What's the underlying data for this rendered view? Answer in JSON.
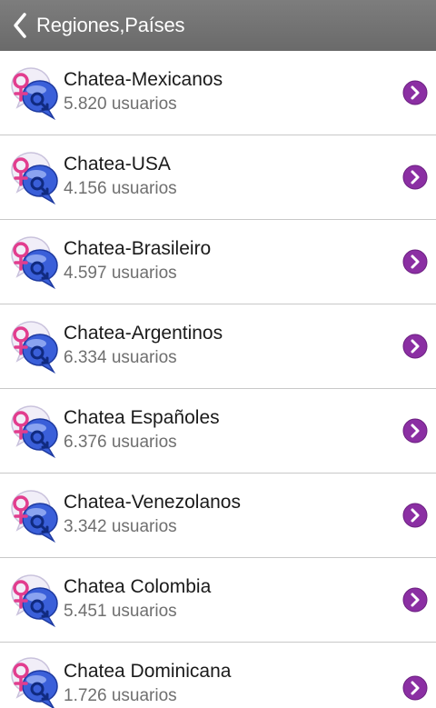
{
  "header": {
    "title": "Regiones,Países"
  },
  "icons": {
    "back": "chevron-left-icon",
    "item": "gender-chat-bubble-icon",
    "go": "purple-chevron-right-icon"
  },
  "colors": {
    "header": "#747474",
    "accent": "#8b2fa3",
    "divider": "#c8c8c8"
  },
  "rooms": [
    {
      "name": "Chatea-Mexicanos",
      "users": "5.820 usuarios"
    },
    {
      "name": "Chatea-USA",
      "users": "4.156 usuarios"
    },
    {
      "name": "Chatea-Brasileiro",
      "users": "4.597 usuarios"
    },
    {
      "name": "Chatea-Argentinos",
      "users": "6.334 usuarios"
    },
    {
      "name": "Chatea Españoles",
      "users": "6.376 usuarios"
    },
    {
      "name": "Chatea-Venezolanos",
      "users": "3.342 usuarios"
    },
    {
      "name": "Chatea Colombia",
      "users": "5.451 usuarios"
    },
    {
      "name": "Chatea Dominicana",
      "users": "1.726 usuarios"
    }
  ]
}
